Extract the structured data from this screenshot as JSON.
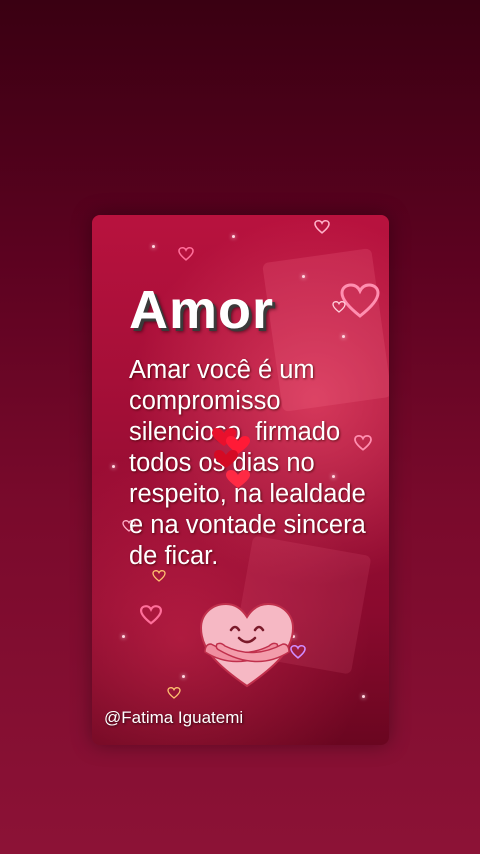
{
  "card": {
    "title": "Amor",
    "body": "Amar você é um compromisso silencioso, firmado todos os dias no respeito, na lealdade e na vontade sincera de ficar.",
    "credit": "@Fatima Iguatemi"
  },
  "colors": {
    "page_background": "#5c0220",
    "card_background": "#a00e36",
    "text": "#ffffff",
    "heart_outline": "#ff8fb0",
    "hug_heart": "#f6b8c4"
  },
  "icons": [
    "heart-outline-icon",
    "red-heart-icon",
    "hugging-heart-icon"
  ]
}
